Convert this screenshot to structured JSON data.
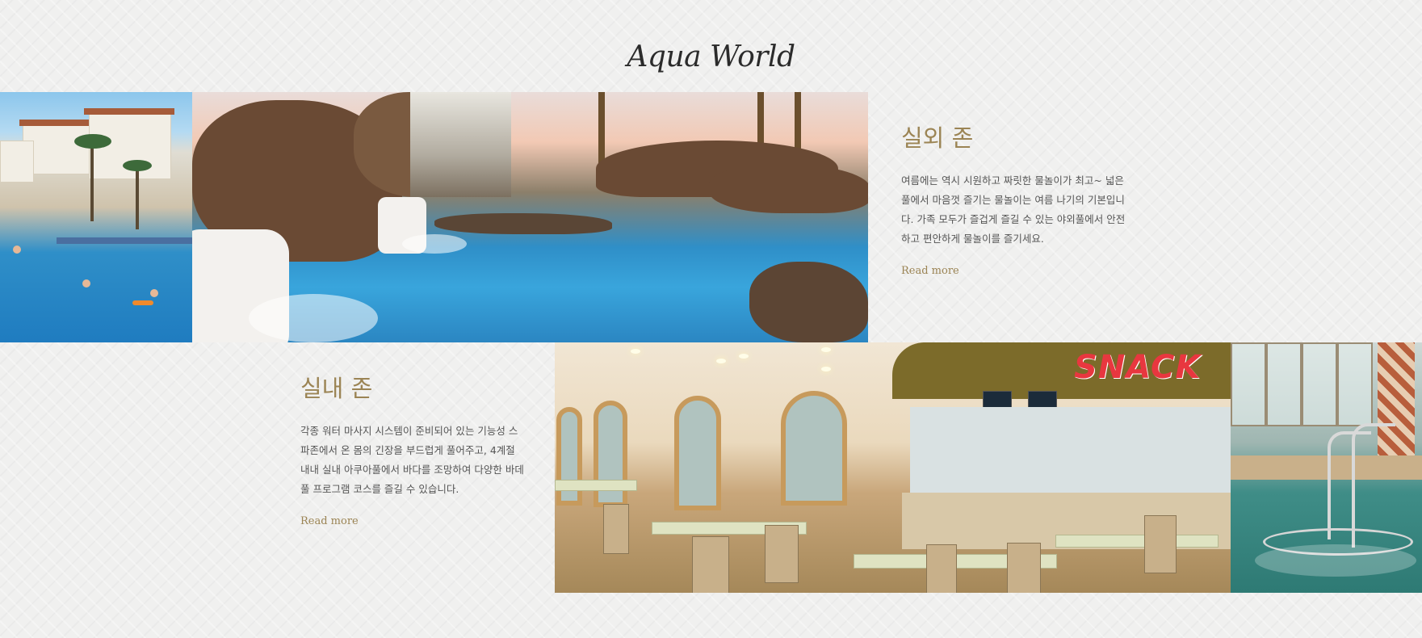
{
  "section": {
    "title": "Aqua World"
  },
  "outdoor": {
    "title": "실외 존",
    "description": "여름에는 역시 시원하고 짜릿한 물놀이가 최고~ 넓은 풀에서 마음껏 즐기는 물놀이는 여름 나기의 기본입니다. 가족 모두가 즐겁게 즐길 수 있는 야외풀에서 안전하고 편안하게 물놀이를 즐기세요.",
    "link": "Read more"
  },
  "indoor": {
    "title": "실내 존",
    "description": "각종 워터 마사지 시스템이 준비되어 있는 기능성 스파존에서 온 몸의 긴장을 부드럽게 풀어주고, 4계절 내내 실내 아쿠아풀에서 바다를 조망하여 다양한 바데풀 프로그램 코스를 즐길 수 있습니다.",
    "link": "Read more"
  },
  "photos": {
    "snack_sign": "SNACK"
  },
  "colors": {
    "accent": "#9b8454",
    "background": "#f0f0ef",
    "heading": "#2b2b2b"
  }
}
